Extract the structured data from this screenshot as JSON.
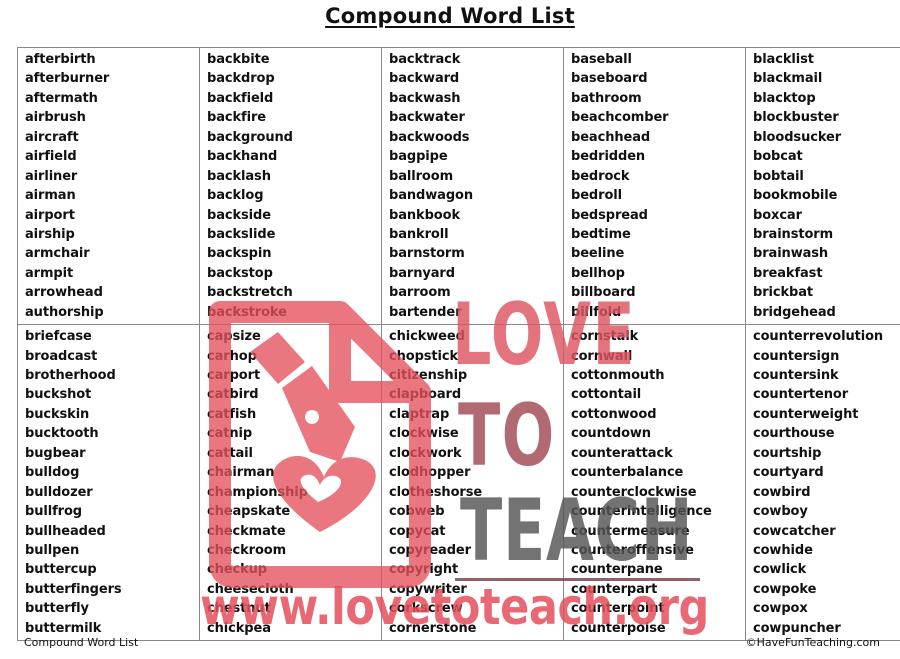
{
  "document": {
    "title": "Compound Word List",
    "footer_left": "Compound Word List",
    "footer_right": "©HaveFunTeaching.com"
  },
  "table": {
    "rows": [
      {
        "columns": [
          [
            "afterbirth",
            "afterburner",
            "aftermath",
            "airbrush",
            "aircraft",
            "airfield",
            "airliner",
            "airman",
            "airport",
            "airship",
            "armchair",
            "armpit",
            "arrowhead",
            "authorship"
          ],
          [
            "backbite",
            "backdrop",
            "backfield",
            "backfire",
            "background",
            "backhand",
            "backlash",
            "backlog",
            "backside",
            "backslide",
            "backspin",
            "backstop",
            "backstretch",
            "backstroke"
          ],
          [
            "backtrack",
            "backward",
            "backwash",
            "backwater",
            "backwoods",
            "bagpipe",
            "ballroom",
            "bandwagon",
            "bankbook",
            "bankroll",
            "barnstorm",
            "barnyard",
            "barroom",
            "bartender"
          ],
          [
            "baseball",
            "baseboard",
            "bathroom",
            "beachcomber",
            "beachhead",
            "bedridden",
            "bedrock",
            "bedroll",
            "bedspread",
            "bedtime",
            "beeline",
            "bellhop",
            "billboard",
            "billfold"
          ],
          [
            "blacklist",
            "blackmail",
            "blacktop",
            "blockbuster",
            "bloodsucker",
            "bobcat",
            "bobtail",
            "bookmobile",
            "boxcar",
            "brainstorm",
            "brainwash",
            "breakfast",
            "brickbat",
            "bridgehead"
          ]
        ]
      },
      {
        "columns": [
          [
            "briefcase",
            "broadcast",
            "brotherhood",
            "buckshot",
            "buckskin",
            "bucktooth",
            "bugbear",
            "bulldog",
            "bulldozer",
            "bullfrog",
            "bullheaded",
            "bullpen",
            "buttercup",
            "butterfingers",
            "butterfly",
            "buttermilk"
          ],
          [
            "capsize",
            "carhop",
            "carport",
            "catbird",
            "catfish",
            "catnip",
            "cattail",
            "chairman",
            "championship",
            "cheapskate",
            "checkmate",
            "checkroom",
            "checkup",
            "cheesecloth",
            "chestnut",
            "chickpea"
          ],
          [
            "chickweed",
            "chopstick",
            "citizenship",
            "clapboard",
            "claptrap",
            "clockwise",
            "clockwork",
            "clodhopper",
            "clotheshorse",
            "cobweb",
            "copycat",
            "copyreader",
            "copyright",
            "copywriter",
            "corkscrew",
            "cornerstone"
          ],
          [
            "cornstalk",
            "cornwall",
            "cottonmouth",
            "cottontail",
            "cottonwood",
            "countdown",
            "counterattack",
            "counterbalance",
            "counterclockwise",
            "counterintelligence",
            "countermeasure",
            "counteroffensive",
            "counterpane",
            "counterpart",
            "counterpoint",
            "counterpoise"
          ],
          [
            "counterrevolution",
            "countersign",
            "countersink",
            "countertenor",
            "counterweight",
            "courthouse",
            "courtship",
            "courtyard",
            "cowbird",
            "cowboy",
            "cowcatcher",
            "cowhide",
            "cowlick",
            "cowpoke",
            "cowpox",
            "cowpuncher"
          ]
        ]
      }
    ]
  },
  "watermark": {
    "icon": "pen-heart-document-icon",
    "line1": "LOVE",
    "line2": "TO",
    "line3": "TEACH",
    "url": "www.lovetoteach.org",
    "colors": {
      "red": "#e5505c",
      "maroon": "#a24a52",
      "gray": "#555555"
    }
  }
}
